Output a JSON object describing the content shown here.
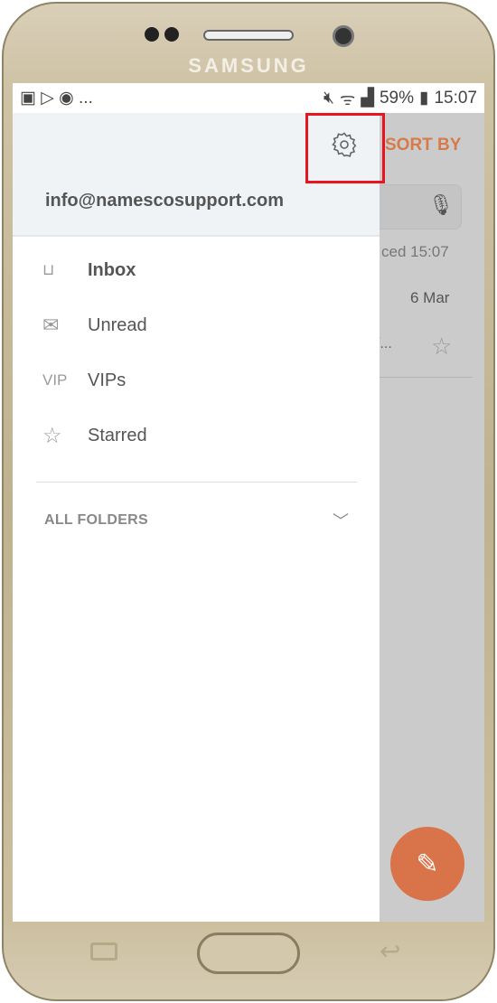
{
  "device": {
    "brand": "SAMSUNG"
  },
  "status_bar": {
    "left_icons": [
      "image-icon",
      "play-store-icon",
      "notification-icon"
    ],
    "more": "...",
    "battery": "59%",
    "time": "15:07"
  },
  "background": {
    "sort_by": "SORT BY",
    "synced": "ced  15:07",
    "date": "6 Mar",
    "preview": "/..."
  },
  "drawer": {
    "account_email": "info@namescosupport.com",
    "items": [
      {
        "label": "Inbox",
        "icon": "inbox-icon",
        "bold": true
      },
      {
        "label": "Unread",
        "icon": "envelope-icon"
      },
      {
        "label": "VIPs",
        "icon": "VIP"
      },
      {
        "label": "Starred",
        "icon": "star-icon"
      }
    ],
    "all_folders": "ALL FOLDERS"
  },
  "colors": {
    "accent": "#d9734a",
    "highlight": "#e8141e"
  }
}
